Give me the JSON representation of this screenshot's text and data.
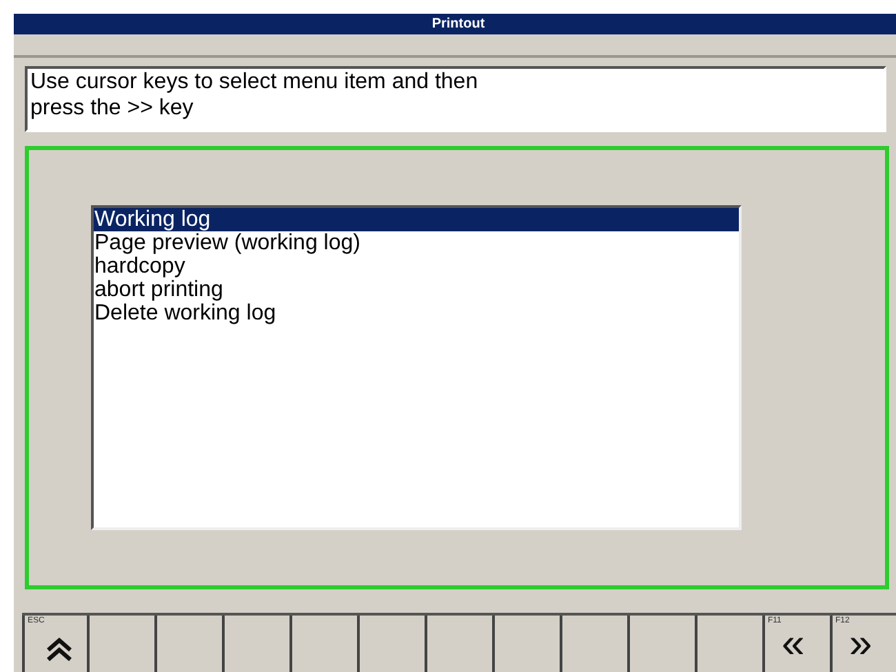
{
  "window": {
    "title": "Printout"
  },
  "message": "Use cursor keys to select menu item and then\npress the >> key",
  "menu": [
    {
      "label": "Working log",
      "selected": true
    },
    {
      "label": "Page preview (working log)",
      "selected": false
    },
    {
      "label": "hardcopy",
      "selected": false
    },
    {
      "label": "abort printing",
      "selected": false
    },
    {
      "label": "Delete working log",
      "selected": false
    }
  ],
  "softkeys": [
    {
      "key": "ESC",
      "kind": "up"
    },
    {
      "kind": "blank"
    },
    {
      "kind": "blank"
    },
    {
      "kind": "blank"
    },
    {
      "kind": "blank"
    },
    {
      "kind": "blank"
    },
    {
      "kind": "blank"
    },
    {
      "kind": "blank"
    },
    {
      "kind": "blank"
    },
    {
      "kind": "blank"
    },
    {
      "kind": "blank"
    },
    {
      "key": "F11",
      "kind": "glyph",
      "glyph": "«"
    },
    {
      "key": "F12",
      "kind": "glyph",
      "glyph": "»"
    }
  ]
}
